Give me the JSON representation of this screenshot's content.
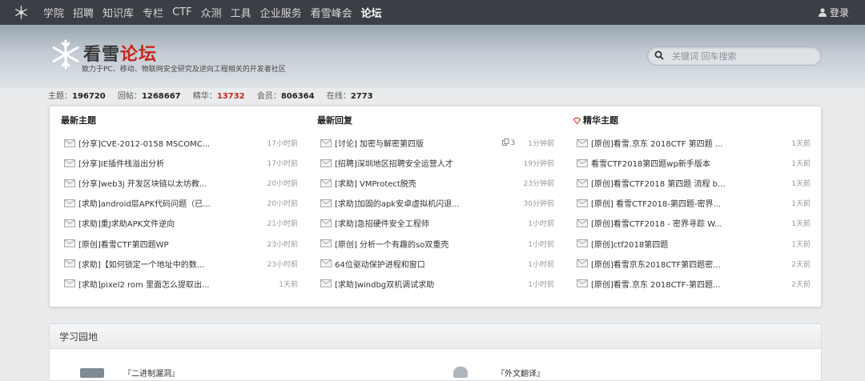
{
  "nav": {
    "items": [
      "学院",
      "招聘",
      "知识库",
      "专栏",
      "CTF",
      "众测",
      "工具",
      "企业服务",
      "看雪峰会",
      "论坛"
    ],
    "active": "论坛",
    "login": "登录"
  },
  "brand": {
    "name_black": "看雪",
    "name_red": "论坛",
    "slogan": "致力于PC、移动、物联网安全研究及逆向工程相关的开发者社区"
  },
  "search": {
    "placeholder": "关键词 回车搜索"
  },
  "stats": {
    "topics_label": "主题：",
    "topics": "196720",
    "replies_label": "回帖：",
    "replies": "1268667",
    "digest_label": "精华：",
    "digest": "13732",
    "members_label": "会员：",
    "members": "806364",
    "online_label": "在线：",
    "online": "2773"
  },
  "columns": {
    "latest_topics": {
      "title": "最新主题",
      "rows": [
        {
          "title": "[分享]CVE-2012-0158 MSCOMC...",
          "time": "17小时前"
        },
        {
          "title": "[分享]IE插件栈溢出分析",
          "time": "17小时前"
        },
        {
          "title": "[分享]web3j 开发区块链以太坊教...",
          "time": "20小时前"
        },
        {
          "title": "[求助]android层APK代码问题（已...",
          "time": "20小时前"
        },
        {
          "title": "[求助]重J求助APK文件逆向",
          "time": "21小时前"
        },
        {
          "title": "[原创]看雪CTF第四题WP",
          "time": "23小时前"
        },
        {
          "title": "[求助]【如何锁定一个地址中的数...",
          "time": "23小时前"
        },
        {
          "title": "[求助]pixel2 rom 里面怎么提取出...",
          "time": "1天前"
        }
      ]
    },
    "latest_replies": {
      "title": "最新回复",
      "rows": [
        {
          "title": "[讨论] 加密与解密第四版",
          "count": "3",
          "time": "1分钟前"
        },
        {
          "title": "[招聘]深圳地区招聘安全运营人才",
          "count": "",
          "time": "19分钟前"
        },
        {
          "title": "[求助] VMProtect脱壳",
          "count": "",
          "time": "23分钟前"
        },
        {
          "title": "[求助]加固的apk安卓虚拟机闪退...",
          "count": "",
          "time": "30分钟前"
        },
        {
          "title": "[求助]急招硬件安全工程师",
          "count": "",
          "time": "1小时前"
        },
        {
          "title": "[原创] 分析一个有趣的so双重壳",
          "count": "",
          "time": "1小时前"
        },
        {
          "title": "64位驱动保护进程和窗口",
          "count": "",
          "time": "1小时前"
        },
        {
          "title": "[求助]windbg双机调试求助",
          "count": "",
          "time": "1小时前"
        }
      ]
    },
    "digest_topics": {
      "title": "精华主题",
      "rows": [
        {
          "title": "[原创]看雪.京东 2018CTF 第四题 ...",
          "time": "1天前"
        },
        {
          "title": "看雪CTF2018第四题wp新手版本",
          "time": "1天前"
        },
        {
          "title": "[原创]看雪CTF2018 第四题 流程 b...",
          "time": "1天前"
        },
        {
          "title": "[原创] 看雪CTF2018-第四题-密界...",
          "time": "1天前"
        },
        {
          "title": "[原创]看雪CTF2018 - 密界寻踪 W...",
          "time": "1天前"
        },
        {
          "title": "[原创]ctf2018第四题",
          "time": "1天前"
        },
        {
          "title": "[原创]看雪京东2018CTF第四题密...",
          "time": "2天前"
        },
        {
          "title": "[原创]看雪.京东 2018CTF-第四题...",
          "time": "2天前"
        }
      ]
    }
  },
  "learn": {
    "title": "学习园地",
    "items": [
      "『二进制漏洞』",
      "『外文翻译』"
    ]
  },
  "colors": {
    "nav_bg": "#3b3e44",
    "accent_red": "#c8261c"
  }
}
